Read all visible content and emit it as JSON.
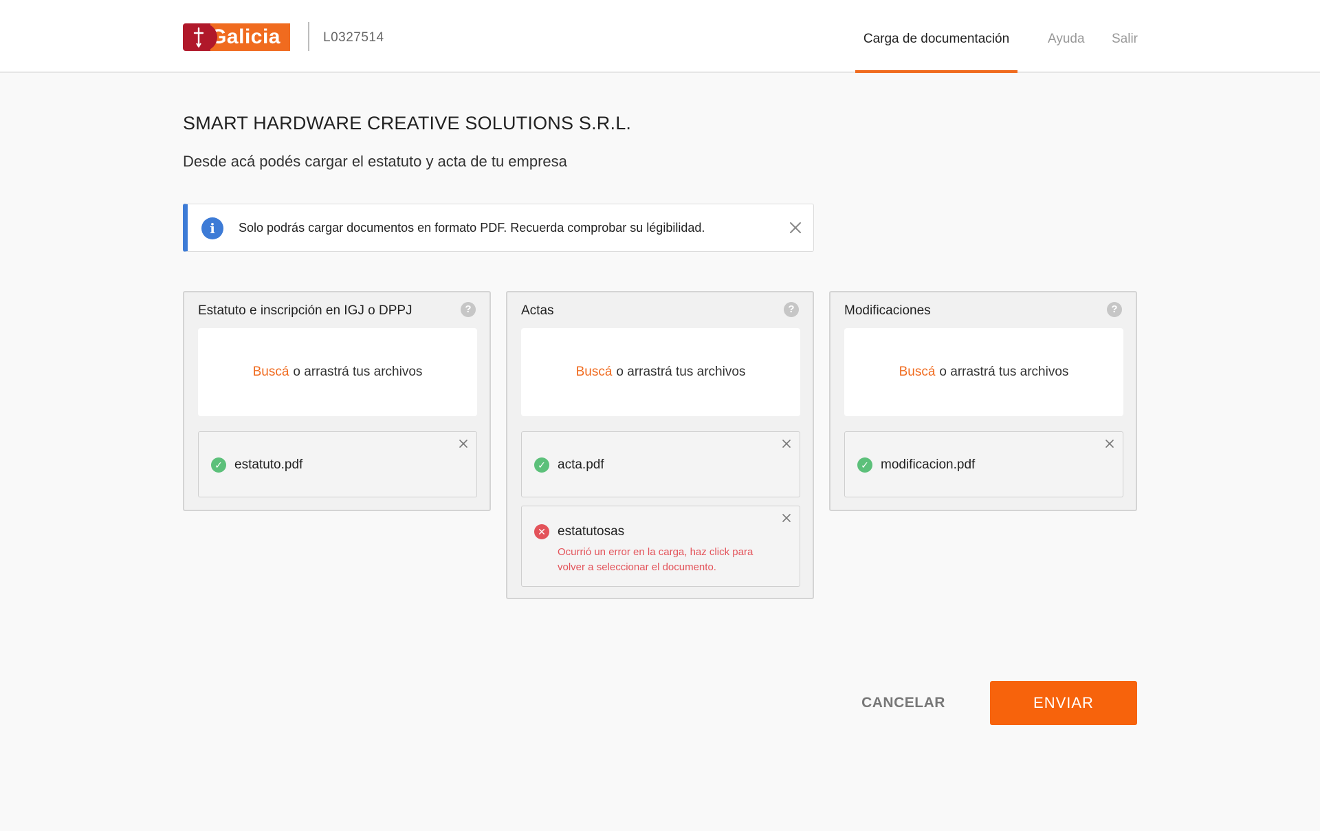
{
  "brand": {
    "name": "Galicia",
    "primary_color": "#f06b1f",
    "mark_color": "#b0182a"
  },
  "header": {
    "account_id": "L0327514",
    "nav": [
      {
        "label": "Carga de documentación",
        "active": true
      },
      {
        "label": "Ayuda",
        "active": false
      },
      {
        "label": "Salir",
        "active": false
      }
    ]
  },
  "page": {
    "company_name": "SMART HARDWARE CREATIVE SOLUTIONS S.R.L.",
    "subtitle": "Desde acá podés cargar el estatuto y acta de tu empresa"
  },
  "banner": {
    "icon": "info-icon",
    "text": "Solo podrás cargar documentos en formato PDF. Recuerda comprobar su légibilidad.",
    "accent_color": "#3d7bd6"
  },
  "cards": [
    {
      "title": "Estatuto e inscripción en IGJ o DPPJ",
      "dropzone": {
        "link": "Buscá",
        "text": "o arrastrá tus archivos"
      },
      "files": [
        {
          "name": "estatuto.pdf",
          "status": "ok"
        }
      ]
    },
    {
      "title": "Actas",
      "dropzone": {
        "link": "Buscá",
        "text": "o arrastrá tus archivos"
      },
      "files": [
        {
          "name": "acta.pdf",
          "status": "ok"
        },
        {
          "name": "estatutosas",
          "status": "error",
          "error_message": "Ocurrió un error en la carga, haz click para volver a seleccionar el documento."
        }
      ]
    },
    {
      "title": "Modificaciones",
      "dropzone": {
        "link": "Buscá",
        "text": "o arrastrá tus archivos"
      },
      "files": [
        {
          "name": "modificacion.pdf",
          "status": "ok"
        }
      ]
    }
  ],
  "status_colors": {
    "ok": "#5cc07a",
    "error": "#e3535a"
  },
  "actions": {
    "cancel_label": "CANCELAR",
    "send_label": "ENVIAR"
  }
}
